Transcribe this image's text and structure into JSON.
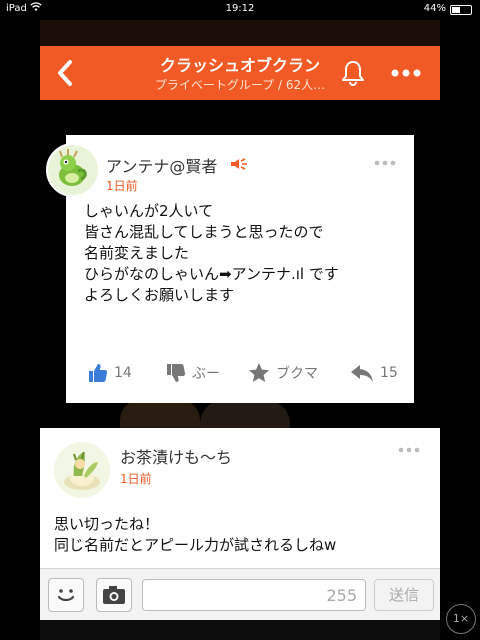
{
  "status_bar": {
    "carrier": "iPad",
    "wifi_icon": "wifi-icon",
    "time": "19:12",
    "battery_percent": "44%",
    "battery_level": 0.44
  },
  "header": {
    "title": "クラッシュオブクラン",
    "subtitle": "プライベートグループ / 62人…",
    "back_icon": "chevron-left-icon",
    "bell_icon": "bell-icon",
    "more_icon": "more-dots-icon",
    "color": "#f15a24"
  },
  "posts": [
    {
      "username": "アンテナ@賢者",
      "time_ago": "1日前",
      "badge_icon": "speaker-badge-icon",
      "lines": [
        "しゃいんが2人いて",
        "皆さん混乱してしまうと思ったので",
        "名前変えました",
        "ひらがなのしゃいん➡アンテナ.ıl です",
        "よろしくお願いします"
      ],
      "actions": {
        "like_count": "14",
        "boo_label": "ぶー",
        "bookmark_label": "ブクマ",
        "reply_count": "15"
      }
    },
    {
      "username": "お茶漬けも〜ち",
      "time_ago": "1日前",
      "lines": [
        "思い切ったね！",
        "同じ名前だとアピール力が試されるしねw"
      ]
    }
  ],
  "composer": {
    "char_counter": "255",
    "send_label": "送信",
    "emoji_icon": "emoji-icon",
    "camera_icon": "camera-icon"
  },
  "zoom_label": "1×"
}
